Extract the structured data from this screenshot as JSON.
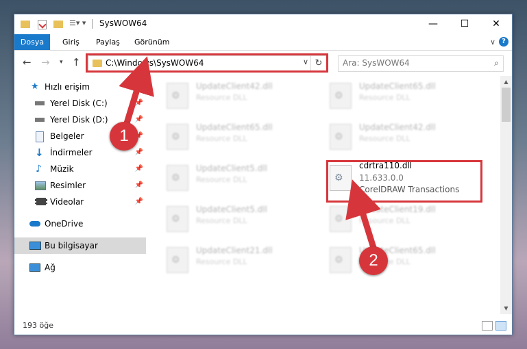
{
  "window": {
    "title": "SysWOW64",
    "controls": {
      "minimize": "—",
      "maximize": "☐",
      "close": "✕"
    }
  },
  "ribbon": {
    "tabs": [
      "Dosya",
      "Giriş",
      "Paylaş",
      "Görünüm"
    ],
    "expand": "∨",
    "help": "?"
  },
  "nav": {
    "address": "C:\\Windows\\SysWOW64",
    "search_placeholder": "Ara: SysWOW64"
  },
  "sidebar": {
    "items": [
      {
        "label": "Hızlı erişim",
        "icon": "star-icon",
        "pinned": false
      },
      {
        "label": "Yerel Disk (C:)",
        "icon": "drive-icon",
        "pinned": true
      },
      {
        "label": "Yerel Disk (D:)",
        "icon": "drive-icon",
        "pinned": true
      },
      {
        "label": "Belgeler",
        "icon": "documents-icon",
        "pinned": true
      },
      {
        "label": "İndirmeler",
        "icon": "download-icon",
        "pinned": true
      },
      {
        "label": "Müzik",
        "icon": "music-icon",
        "pinned": true
      },
      {
        "label": "Resimler",
        "icon": "pictures-icon",
        "pinned": true
      },
      {
        "label": "Videolar",
        "icon": "videos-icon",
        "pinned": true
      },
      {
        "label": "OneDrive",
        "icon": "cloud-icon",
        "pinned": false
      },
      {
        "label": "Bu bilgisayar",
        "icon": "computer-icon",
        "pinned": false
      },
      {
        "label": "Ağ",
        "icon": "network-icon",
        "pinned": false
      }
    ]
  },
  "files": [
    {
      "name": "UpdateClient42.dll",
      "desc": "Resource DLL"
    },
    {
      "name": "UpdateClient65.dll",
      "desc": "Resource DLL"
    },
    {
      "name": "UpdateClient65.dll",
      "desc": "Resource DLL"
    },
    {
      "name": "UpdateClient42.dll",
      "desc": "Resource DLL"
    },
    {
      "name": "UpdateClient5.dll",
      "desc": "Resource DLL"
    },
    {
      "name": "cdrtra110.dll",
      "version": "11.633.0.0",
      "desc": "CorelDRAW Transactions"
    },
    {
      "name": "UpdateClient5.dll",
      "desc": "Resource DLL"
    },
    {
      "name": "UpdateClient19.dll",
      "desc": "Resource DLL"
    },
    {
      "name": "UpdateClient21.dll",
      "desc": "Resource DLL"
    },
    {
      "name": "UpdateClient65.dll",
      "desc": "Resource DLL"
    }
  ],
  "status": {
    "count": "193 öğe"
  },
  "callouts": [
    "1",
    "2"
  ],
  "colors": {
    "accent": "#1979ca",
    "annotation": "#d6363b"
  }
}
